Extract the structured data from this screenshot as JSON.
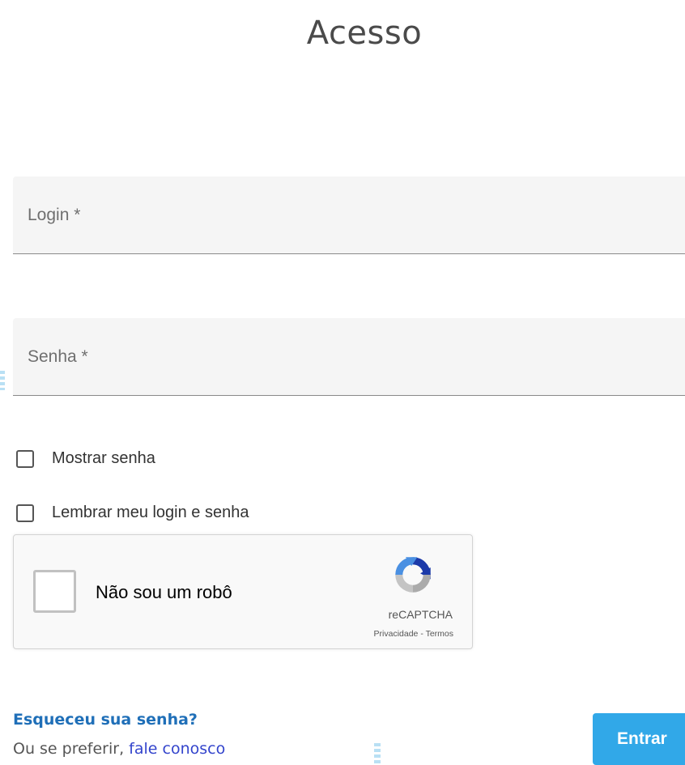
{
  "page": {
    "title": "Acesso"
  },
  "form": {
    "login_placeholder": "Login *",
    "password_placeholder": "Senha *",
    "show_password_label": "Mostrar senha",
    "remember_label": "Lembrar meu login e senha",
    "show_password_checked": false,
    "remember_checked": false
  },
  "recaptcha": {
    "label": "Não sou um robô",
    "brand": "reCAPTCHA",
    "privacy": "Privacidade",
    "separator": " - ",
    "terms": "Termos",
    "checked": false,
    "logo_icon": "recaptcha-logo-icon"
  },
  "footer": {
    "forgot_text": "Esqueceu sua senha?",
    "prefer_text": "Ou se preferir, ",
    "contact_link": "fale conosco",
    "submit_label": "Entrar"
  },
  "colors": {
    "accent": "#31a8e8",
    "link": "#1f6fb8",
    "contact_link": "#3344cc",
    "title": "#4a4a4a"
  }
}
